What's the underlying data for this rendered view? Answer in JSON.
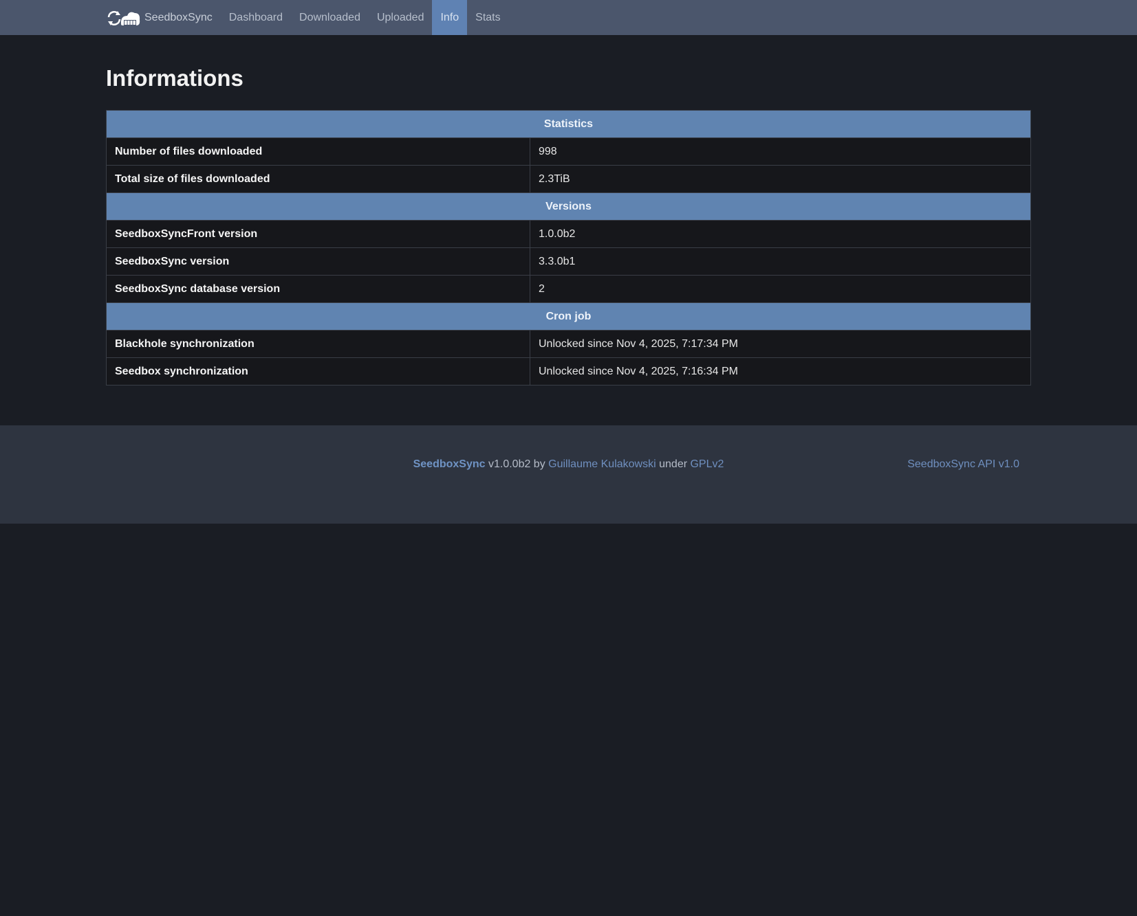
{
  "nav": {
    "brand": "SeedboxSync",
    "links": [
      "Dashboard",
      "Downloaded",
      "Uploaded",
      "Info",
      "Stats"
    ],
    "active": "Info"
  },
  "page_title": "Informations",
  "sections": {
    "statistics": {
      "title": "Statistics",
      "rows": [
        {
          "label": "Number of files downloaded",
          "value": "998"
        },
        {
          "label": "Total size of files downloaded",
          "value": "2.3TiB"
        }
      ]
    },
    "versions": {
      "title": "Versions",
      "rows": [
        {
          "label": "SeedboxSyncFront version",
          "value": "1.0.0b2"
        },
        {
          "label": "SeedboxSync version",
          "value": "3.3.0b1"
        },
        {
          "label": "SeedboxSync database version",
          "value": "2"
        }
      ]
    },
    "cron": {
      "title": "Cron job",
      "rows": [
        {
          "label": "Blackhole synchronization",
          "value": "Unlocked since Nov 4, 2025, 7:17:34 PM"
        },
        {
          "label": "Seedbox synchronization",
          "value": "Unlocked since Nov 4, 2025, 7:16:34 PM"
        }
      ]
    }
  },
  "footer": {
    "brand": "SeedboxSync",
    "version_text": " v1.0.0b2 by ",
    "author": "Guillaume Kulakowski",
    "under_text": " under ",
    "license": "GPLv2",
    "api_link": "SeedboxSync API v1.0"
  },
  "colors": {
    "navbar": "#4b566c",
    "active_tab": "#5f82b3",
    "section_header": "#6084b1",
    "background": "#1a1d24",
    "footer": "#2e3440",
    "link": "#6f8fbf"
  },
  "icons": {
    "logo": "sync-cloud-logo-icon"
  }
}
